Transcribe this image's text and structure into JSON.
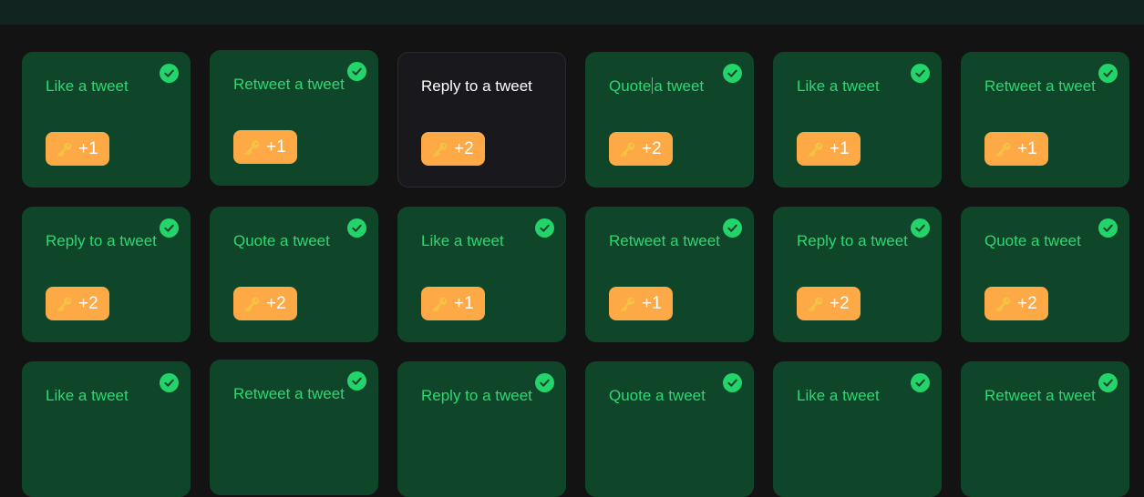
{
  "cards": [
    {
      "title": "Like a tweet",
      "reward": "+1",
      "completed": true
    },
    {
      "title": "Retweet a tweet",
      "reward": "+1",
      "completed": true
    },
    {
      "title": "Reply to a tweet",
      "reward": "+2",
      "completed": false
    },
    {
      "title": "Quote a tweet",
      "reward": "+2",
      "completed": true
    },
    {
      "title": "Like a tweet",
      "reward": "+1",
      "completed": true
    },
    {
      "title": "Retweet a tweet",
      "reward": "+1",
      "completed": true
    },
    {
      "title": "Reply to a tweet",
      "reward": "+2",
      "completed": true
    },
    {
      "title": "Quote a tweet",
      "reward": "+2",
      "completed": true
    },
    {
      "title": "Like a tweet",
      "reward": "+1",
      "completed": true
    },
    {
      "title": "Retweet a tweet",
      "reward": "+1",
      "completed": true
    },
    {
      "title": "Reply to a tweet",
      "reward": "+2",
      "completed": true
    },
    {
      "title": "Quote a tweet",
      "reward": "+2",
      "completed": true
    },
    {
      "title": "Like a tweet",
      "reward": "",
      "completed": true
    },
    {
      "title": "Retweet a tweet",
      "reward": "",
      "completed": true
    },
    {
      "title": "Reply to a tweet",
      "reward": "",
      "completed": true
    },
    {
      "title": "Quote a tweet",
      "reward": "",
      "completed": true
    },
    {
      "title": "Like a tweet",
      "reward": "",
      "completed": true
    },
    {
      "title": "Retweet a tweet",
      "reward": "",
      "completed": true
    }
  ],
  "icons": {
    "completed": "check-circle-icon",
    "reward": "key-icon"
  },
  "colors": {
    "page_background": "#131313",
    "top_bar": "#122420",
    "card_completed": "#0f4629",
    "card_pending": "#19181d",
    "title_completed": "#2cd872",
    "title_pending": "#ffffff",
    "check": "#22d46a",
    "reward_badge": "#fda945"
  }
}
